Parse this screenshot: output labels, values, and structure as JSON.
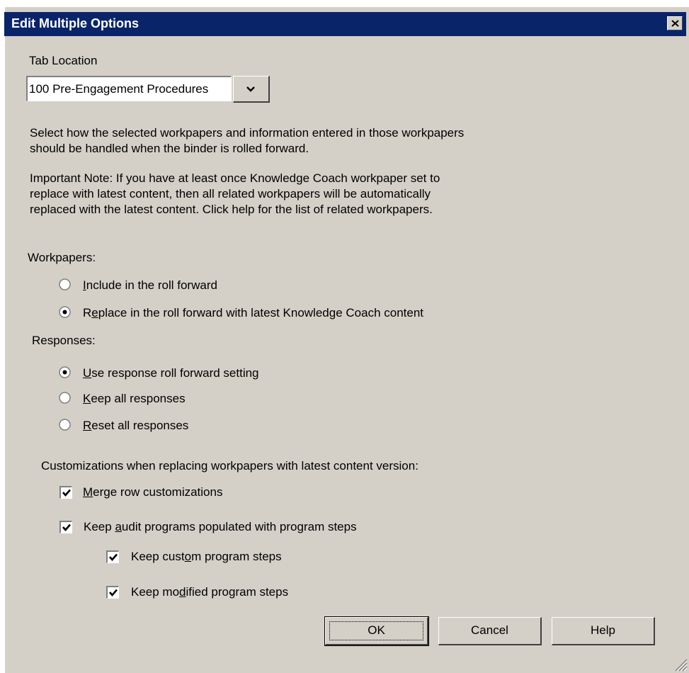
{
  "window": {
    "title": "Edit Multiple Options"
  },
  "tab_location": {
    "label": "Tab Location",
    "selected": "100 Pre-Engagement Procedures"
  },
  "description": {
    "line1": "Select how the selected workpapers and information entered in those workpapers",
    "line2": "should be handled when the binder is rolled forward."
  },
  "note": {
    "line1": "Important Note: If you have at least once Knowledge Coach workpaper set to",
    "line2": "replace with latest content, then all related workpapers will be automatically",
    "line3": "replaced with the latest content. Click help for the list of related workpapers."
  },
  "workpapers": {
    "label": "Workpapers:",
    "options": [
      {
        "pre": "",
        "key": "I",
        "post": "nclude in the roll forward",
        "selected": false
      },
      {
        "pre": "R",
        "key": "e",
        "post": "place in the roll forward with latest Knowledge Coach content",
        "selected": true
      }
    ]
  },
  "responses": {
    "label": "Responses:",
    "options": [
      {
        "pre": "",
        "key": "U",
        "post": "se response roll forward setting",
        "selected": true
      },
      {
        "pre": "",
        "key": "K",
        "post": "eep all responses",
        "selected": false
      },
      {
        "pre": "",
        "key": "R",
        "post": "eset all responses",
        "selected": false
      }
    ]
  },
  "customizations": {
    "label": "Customizations when replacing workpapers with latest content version:",
    "merge": {
      "pre": "",
      "key": "M",
      "post": "erge row customizations",
      "checked": true
    },
    "keep_audit": {
      "pre": "Keep ",
      "key": "a",
      "post": "udit programs populated with program steps",
      "checked": true
    },
    "keep_custom": {
      "pre": "Keep cust",
      "key": "o",
      "post": "m program steps",
      "checked": true
    },
    "keep_modified": {
      "pre": "Keep mo",
      "key": "d",
      "post": "ified program steps",
      "checked": true
    }
  },
  "buttons": {
    "ok": "OK",
    "cancel": "Cancel",
    "help": "Help"
  },
  "colors": {
    "titlebar": "#0a246a",
    "dialog": "#d4d0c8"
  },
  "icons": {
    "close": "close-icon",
    "dropdown": "chevron-down-icon",
    "grip": "resize-grip-icon"
  }
}
